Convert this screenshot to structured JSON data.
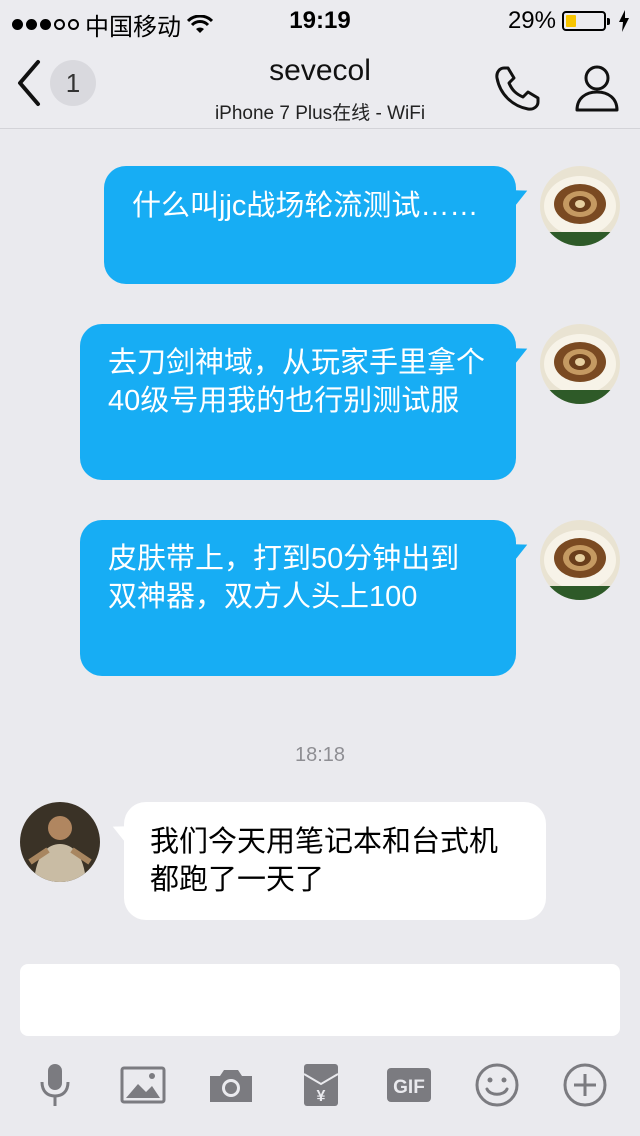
{
  "status_bar": {
    "carrier": "中国移动",
    "time": "19:19",
    "battery_percent": "29%",
    "battery_level": 0.29
  },
  "nav": {
    "back_badge": "1",
    "title": "sevecol",
    "subtitle": "iPhone 7 Plus在线 - WiFi"
  },
  "messages": [
    {
      "side": "out",
      "text": "什么叫jjc战场轮流测试……"
    },
    {
      "side": "out",
      "text": "去刀剑神域，从玩家手里拿个40级号用我的也行别测试服"
    },
    {
      "side": "out",
      "text": "皮肤带上，打到50分钟出到双神器，双方人头上100"
    },
    {
      "side": "in",
      "text": "我们今天用笔记本和台式机都跑了一天了"
    }
  ],
  "timestamp": "18:18",
  "toolbar": {
    "icons": [
      "microphone-icon",
      "image-icon",
      "camera-icon",
      "red-packet-icon",
      "gif-icon",
      "emoji-icon",
      "plus-icon"
    ],
    "gif_label": "GIF",
    "red_packet_symbol": "¥"
  },
  "colors": {
    "outgoing_bubble": "#17adf4",
    "incoming_bubble": "#ffffff",
    "background": "#eaeaee",
    "battery": "#f6c400"
  }
}
